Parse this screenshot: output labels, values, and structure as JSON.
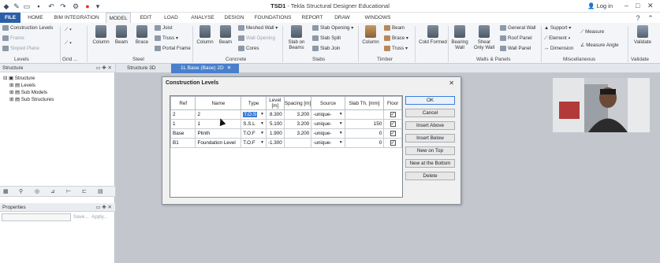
{
  "window": {
    "title_bold": "TSD1",
    "title_rest": " - Tekla Structural Designer Educational",
    "login_label": "Log in"
  },
  "tabs": [
    "FILE",
    "HOME",
    "BIM INTEGRATION",
    "MODEL",
    "EDIT",
    "LOAD",
    "ANALYSE",
    "DESIGN",
    "FOUNDATIONS",
    "REPORT",
    "DRAW",
    "WINDOWS"
  ],
  "active_tab": "MODEL",
  "ribbon": {
    "levels": {
      "construction_levels": "Construction Levels",
      "frame": "Frame",
      "sloped_plane": "Sloped Plane",
      "group": "Levels"
    },
    "grid": {
      "group": "Grid ..."
    },
    "steel": {
      "column": "Column",
      "beam": "Beam",
      "brace": "Brace",
      "joist": "Joist",
      "truss": "Truss",
      "portal_frame": "Portal Frame",
      "group": "Steel"
    },
    "concrete": {
      "column": "Column",
      "beam": "Beam",
      "meshed_wall": "Meshed Wall",
      "wall_opening": "Wall Opening",
      "cores": "Cores",
      "group": "Concrete"
    },
    "slabs": {
      "slab_on_beams_1": "Slab on",
      "slab_on_beams_2": "Beams",
      "slab_opening": "Slab Opening",
      "slab_split": "Slab Split",
      "slab_join": "Slab Join",
      "group": "Slabs"
    },
    "timber": {
      "column": "Column",
      "beam": "Beam",
      "brace": "Brace",
      "truss": "Truss",
      "group": "Timber"
    },
    "cold_formed": {
      "label": "Cold Formed"
    },
    "walls": {
      "bearing_1": "Bearing",
      "bearing_2": "Wall",
      "shear_1": "Shear",
      "shear_2": "Only Wall",
      "general_wall": "General Wall",
      "roof_panel": "Roof Panel",
      "wall_panel": "Wall Panel",
      "group": "Walls & Panels"
    },
    "misc": {
      "support": "Support",
      "element": "Element",
      "dimension": "Dimension",
      "measure": "Measure",
      "measure_angle": "Measure Angle",
      "group": "Miscellaneous"
    },
    "validate": {
      "label": "Validate",
      "group": "Validate"
    }
  },
  "structure_pane": {
    "title": "Structure",
    "tree": [
      "Structure",
      "Levels",
      "Sub Models",
      "Sub Structures"
    ]
  },
  "properties_pane": {
    "title": "Properties",
    "save_label": "Save...",
    "apply_label": "Apply..."
  },
  "doc_tabs": [
    "Structure 3D",
    "1L Base (Base) 2D"
  ],
  "dialog": {
    "title": "Construction Levels",
    "columns": [
      "Ref",
      "Name",
      "Type",
      "Level [m]",
      "Spacing [m]",
      "Source",
      "Slab Th. [mm]",
      "Floor"
    ],
    "rows": [
      {
        "ref": "2",
        "name": "2",
        "type": "T.O.S",
        "level": "8.300",
        "spacing": "3.200",
        "source": "-unique-",
        "slab": "",
        "floor": "checked"
      },
      {
        "ref": "1",
        "name": "1",
        "type": "S.S.L",
        "level": "5.100",
        "spacing": "3.200",
        "source": "-unique-",
        "slab": "150",
        "floor": "checked"
      },
      {
        "ref": "Base",
        "name": "Plinth",
        "type": "T.O.F",
        "level": "1.900",
        "spacing": "3.200",
        "source": "-unique-",
        "slab": "0",
        "floor": "checked"
      },
      {
        "ref": "B1",
        "name": "Foundation Level",
        "type": "T.O.F",
        "level": "-1.300",
        "spacing": "",
        "source": "-unique-",
        "slab": "0",
        "floor": "checked"
      }
    ],
    "buttons": [
      "OK",
      "Cancel",
      "Insert Above",
      "Insert Below",
      "New on Top",
      "New at the Bottom",
      "Delete"
    ]
  },
  "colors": {
    "accent": "#2b5fa8",
    "selection": "#3b7dd8",
    "active_doc_tab": "#4a7fcb"
  }
}
